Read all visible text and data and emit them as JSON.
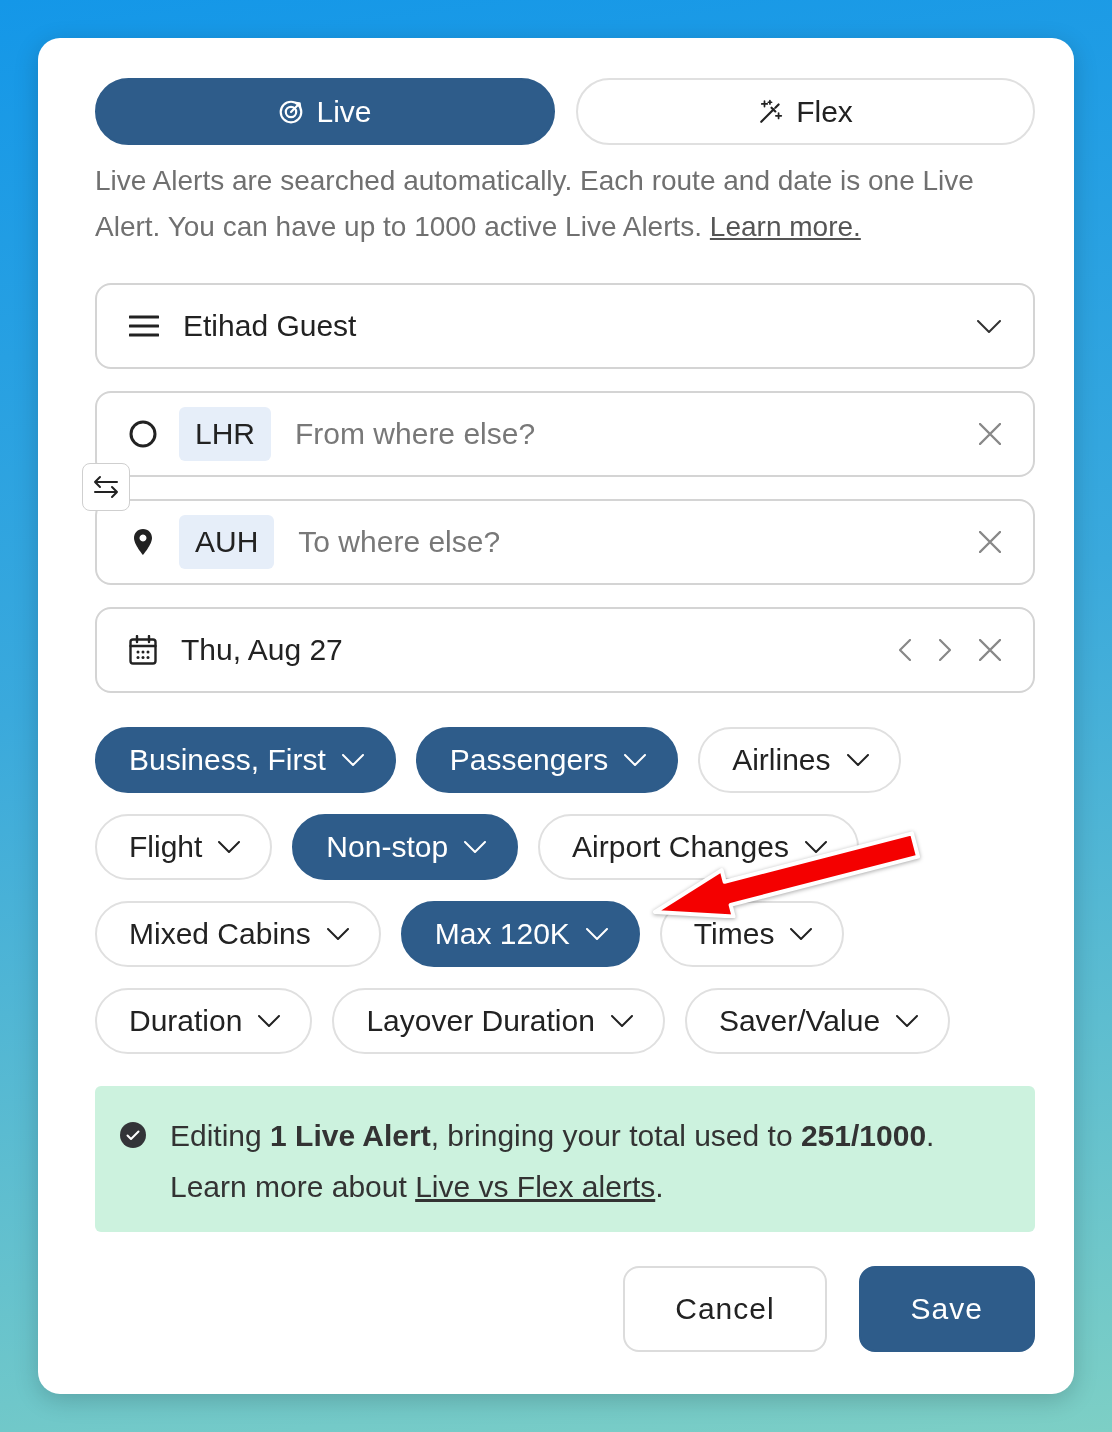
{
  "tabs": [
    {
      "label": "Live",
      "selected": true
    },
    {
      "label": "Flex",
      "selected": false
    }
  ],
  "description": {
    "text": "Live Alerts are searched automatically. Each route and date is one Live Alert. You can have up to 1000 active Live Alerts.",
    "link": "Learn more."
  },
  "program": {
    "value": "Etihad Guest"
  },
  "origin": {
    "code": "LHR",
    "placeholder": "From where else?"
  },
  "destination": {
    "code": "AUH",
    "placeholder": "To where else?"
  },
  "date": {
    "value": "Thu, Aug 27"
  },
  "filter_rows": [
    {
      "chips": [
        {
          "label": "Business, First",
          "selected": true
        },
        {
          "label": "Passengers",
          "selected": true
        },
        {
          "label": "Airlines",
          "selected": false
        }
      ]
    },
    {
      "chips": [
        {
          "label": "Flight",
          "selected": false
        },
        {
          "label": "Non-stop",
          "selected": true
        },
        {
          "label": "Airport Changes",
          "selected": false
        }
      ]
    },
    {
      "chips": [
        {
          "label": "Mixed Cabins",
          "selected": false
        },
        {
          "label": "Max 120K",
          "selected": true
        },
        {
          "label": "Times",
          "selected": false
        }
      ]
    },
    {
      "chips": [
        {
          "label": "Duration",
          "selected": false
        },
        {
          "label": "Layover Duration",
          "selected": false
        },
        {
          "label": "Saver/Value",
          "selected": false
        }
      ]
    }
  ],
  "notice": {
    "text": "Editing **1 Live Alert**, bringing your total used to **251/1000**.",
    "more_text": "Learn more about",
    "link": "Live vs Flex alerts",
    "after_link": "."
  },
  "buttons": [
    {
      "label": "Cancel",
      "kind": "secondary"
    },
    {
      "label": "Save",
      "kind": "primary"
    }
  ]
}
